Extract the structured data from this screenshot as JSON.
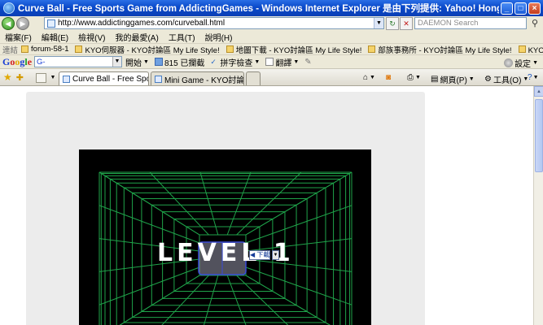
{
  "window": {
    "title": "Curve Ball - Free Sports Game from AddictingGames - Windows Internet Explorer 是由下列提供: Yahoo! Hong Kong - 雅虎香港",
    "minimize": "_",
    "maximize": "□",
    "close": "×"
  },
  "address": {
    "url": "http://www.addictinggames.com/curveball.html",
    "search_placeholder": "DAEMON Search"
  },
  "menu": [
    "檔案(F)",
    "編輯(E)",
    "檢視(V)",
    "我的最愛(A)",
    "工具(T)",
    "說明(H)"
  ],
  "links": {
    "label": "連結",
    "items": [
      "forum-58-1",
      "KYO伺服器 - KYO討論區 My Life Style!",
      "地圖下載 - KYO討論區 My Life Style!",
      "部族事務所 - KYO討論區 My Life Style!",
      "KYO討論區 My Life Style!"
    ]
  },
  "google_bar": {
    "logo": [
      "G",
      "o",
      "o",
      "g",
      "l",
      "e"
    ],
    "search_value": "G-",
    "go_label": "開始",
    "blocked_label": "815 已攔截",
    "spell_label": "拼字檢查",
    "translate_label": "翻譯",
    "settings_label": "設定"
  },
  "tabs": [
    {
      "label": "Curve Ball - Free Sports G...",
      "active": true
    },
    {
      "label": "Mini Game - KYO討論區 魔...",
      "active": false
    }
  ],
  "commands": {
    "page_label": "網頁(P)",
    "tools_label": "工具(O)"
  },
  "game": {
    "level_text": "LEVEL 1",
    "download_badge": "下載"
  },
  "colors": {
    "titlebar": "#0a49c9",
    "chrome": "#ece9d8",
    "grid_line": "#1fa34a"
  }
}
